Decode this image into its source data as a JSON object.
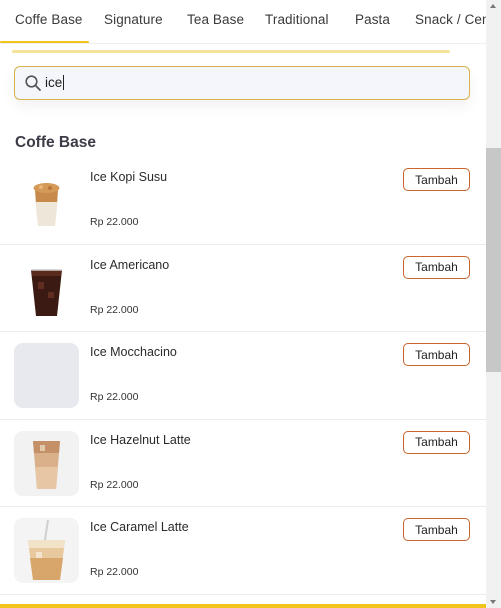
{
  "tabs": [
    {
      "label": "Coffe Base",
      "active": true
    },
    {
      "label": "Signature"
    },
    {
      "label": "Tea Base"
    },
    {
      "label": "Traditional"
    },
    {
      "label": "Pasta"
    },
    {
      "label": "Snack / Cemilan"
    }
  ],
  "search": {
    "value": "ice",
    "icon": "search-icon"
  },
  "section_title": "Coffe Base",
  "add_label": "Tambah",
  "items": [
    {
      "name": "Ice Kopi Susu",
      "price": "Rp 22.000",
      "image": "iced-coffee-milk"
    },
    {
      "name": "Ice Americano",
      "price": "Rp 22.000",
      "image": "iced-americano"
    },
    {
      "name": "Ice Mocchacino",
      "price": "Rp 22.000",
      "image": "placeholder"
    },
    {
      "name": "Ice Hazelnut Latte",
      "price": "Rp 22.000",
      "image": "iced-hazelnut-latte"
    },
    {
      "name": "Ice Caramel Latte",
      "price": "Rp 22.000",
      "image": "iced-caramel-latte"
    }
  ],
  "colors": {
    "accent": "#f0c419",
    "button_border": "#c8662e",
    "search_border": "#d8b24a"
  }
}
